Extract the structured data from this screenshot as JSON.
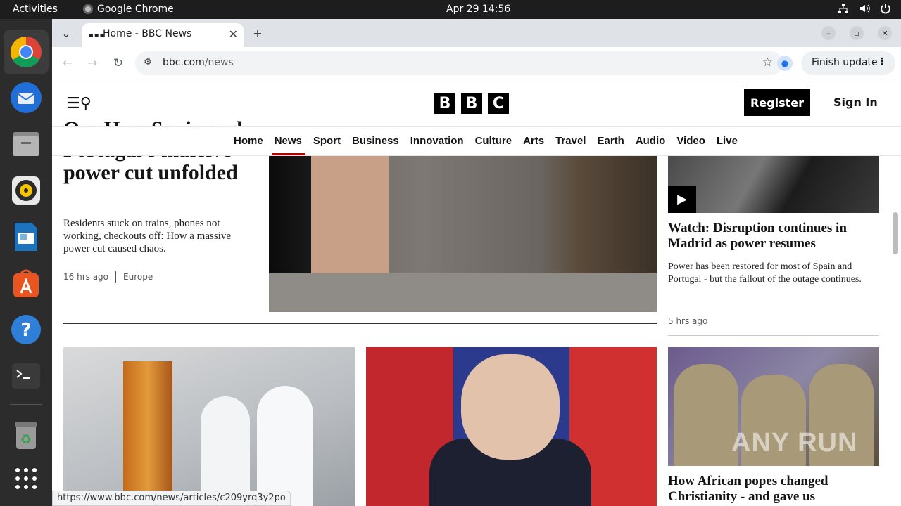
{
  "desktop": {
    "activities": "Activities",
    "app_name": "Google Chrome",
    "clock": "Apr 29  14:56"
  },
  "dock": {
    "items": [
      "chrome",
      "thunderbird",
      "files",
      "rhythmbox",
      "writer",
      "app-center",
      "help",
      "terminal",
      "trash",
      "show-apps"
    ]
  },
  "browser": {
    "tab_title": "Home - BBC News",
    "url_host": "bbc.com",
    "url_path": "/news",
    "finish_update": "Finish update",
    "status_url": "https://www.bbc.com/news/articles/c209yrq3y2po"
  },
  "header": {
    "logo": [
      "B",
      "B",
      "C"
    ],
    "register": "Register",
    "sign_in": "Sign In"
  },
  "nav": {
    "items": [
      "Home",
      "News",
      "Sport",
      "Business",
      "Innovation",
      "Culture",
      "Arts",
      "Travel",
      "Earth",
      "Audio",
      "Video",
      "Live"
    ],
    "active": "News"
  },
  "lead": {
    "title_cut": "On: How Spain and",
    "title": "Portugal's massive power cut unfolded",
    "description": "Residents stuck on trains, phones not working, checkouts off: How a massive power cut caused chaos.",
    "time": "16 hrs ago",
    "section": "Europe"
  },
  "side": {
    "title": "Watch: Disruption continues in Madrid as power resumes",
    "description": "Power has been restored for most of Spain and Portugal - but the fallout of the outage continues.",
    "time": "5 hrs ago"
  },
  "cards": {
    "card3_title": "How African popes changed Christianity - and gave us"
  },
  "watermark": "ANY RUN"
}
